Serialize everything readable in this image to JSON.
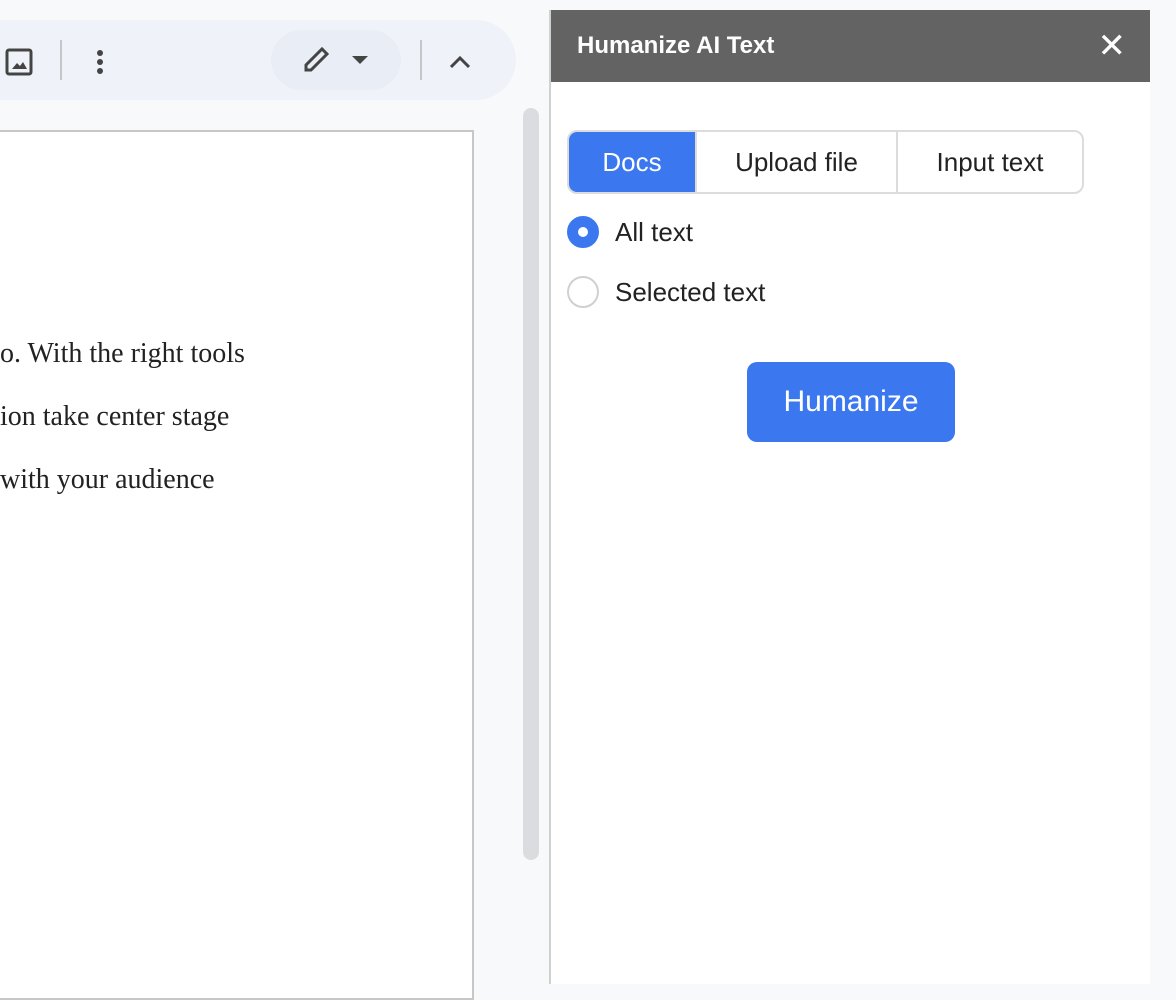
{
  "document": {
    "lines": [
      "o. With the right tools",
      "ion take center stage",
      "with your audience"
    ]
  },
  "toolbar": {
    "icons": [
      "image-icon",
      "more-vert-icon",
      "edit-pencil-icon",
      "dropdown-arrow-icon",
      "chevron-up-icon"
    ]
  },
  "panel": {
    "title": "Humanize AI Text",
    "tabs": [
      "Docs",
      "Upload file",
      "Input text"
    ],
    "active_tab": "Docs",
    "radios": [
      {
        "label": "All text",
        "checked": true
      },
      {
        "label": "Selected text",
        "checked": false
      }
    ],
    "button": "Humanize",
    "accent": "#3b78f0",
    "header_color": "#636363"
  }
}
